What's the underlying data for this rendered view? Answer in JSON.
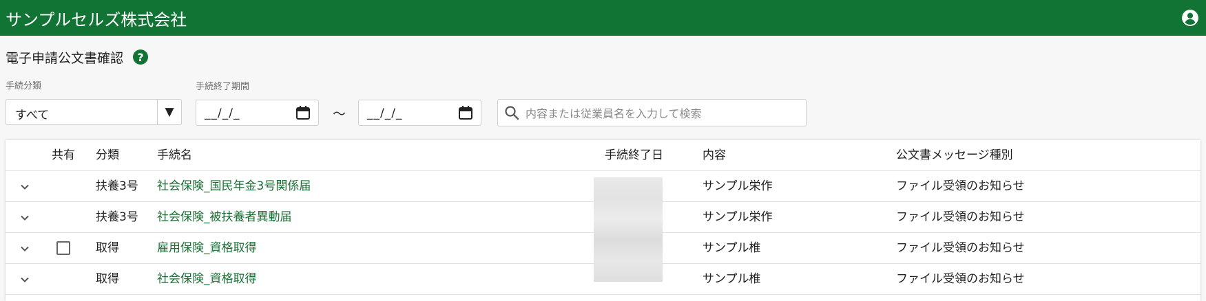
{
  "app": {
    "title": "サンプルセルズ株式会社"
  },
  "page": {
    "title": "電子申請公文書確認"
  },
  "filters": {
    "category_label": "手続分類",
    "category_value": "すべて",
    "period_label": "手続終了期間",
    "date_from_placeholder": "__/_/_",
    "tilde": "～",
    "date_to_placeholder": "__/_/_",
    "search_placeholder": "内容または従業員名を入力して検索"
  },
  "table": {
    "headers": [
      "共有",
      "分類",
      "手続名",
      "手続終了日",
      "内容",
      "公文書メッセージ種別"
    ],
    "rows": [
      {
        "category": "扶養3号",
        "name": "社会保険_国民年金3号関係届",
        "content": "サンプル栄作",
        "type": "ファイル受領のお知らせ"
      },
      {
        "category": "扶養3号",
        "name": "社会保険_被扶養者異動届",
        "content": "サンプル栄作",
        "type": "ファイル受領のお知らせ"
      },
      {
        "category": "取得",
        "name": "雇用保険_資格取得",
        "content": "サンプル椎",
        "type": "ファイル受領のお知らせ"
      },
      {
        "category": "取得",
        "name": "社会保険_資格取得",
        "content": "サンプル椎",
        "type": "ファイル受領のお知らせ"
      }
    ]
  },
  "colors": {
    "brand": "#127434",
    "link": "#1a6e34"
  },
  "icons": [
    "account-circle-icon",
    "help-icon",
    "dropdown-arrow-icon",
    "calendar-icon",
    "search-icon",
    "chevron-down-icon",
    "checkbox-icon"
  ]
}
